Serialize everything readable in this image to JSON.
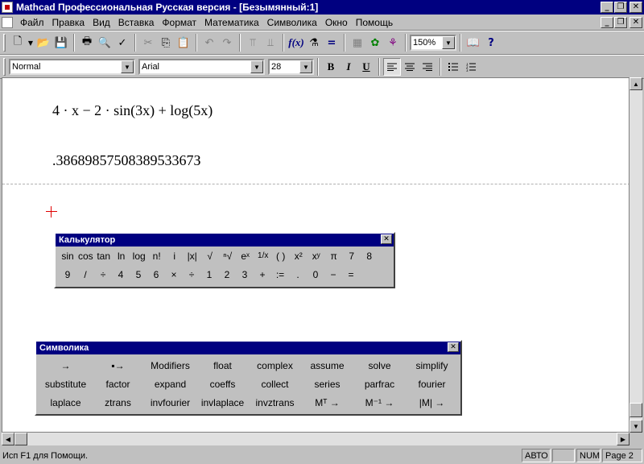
{
  "window": {
    "title": "Mathcad Профессиональная Русская версия - [Безымянный:1]",
    "buttons": [
      "_",
      "❐",
      "✕"
    ]
  },
  "menu": [
    "Файл",
    "Правка",
    "Вид",
    "Вставка",
    "Формат",
    "Математика",
    "Символика",
    "Окно",
    "Помощь"
  ],
  "toolbar": {
    "zoom": "150%"
  },
  "format_bar": {
    "style": "Normal",
    "font": "Arial",
    "size": "28",
    "bold": "B",
    "italic": "I",
    "underline": "U"
  },
  "document": {
    "expression": "4 · x − 2 · sin(3x) + log(5x)",
    "result": ".3868985750838953367З"
  },
  "calculator": {
    "title": "Калькулятор",
    "row1": [
      "sin",
      "cos",
      "tan",
      "ln",
      "log",
      "n!",
      "i",
      "|x|",
      "√",
      "ⁿ√",
      "eˣ",
      "1/x",
      "( )",
      "x²",
      "xʸ",
      "π",
      "7",
      "8"
    ],
    "row2": [
      "9",
      "/",
      "÷",
      "4",
      "5",
      "6",
      "×",
      "÷",
      "1",
      "2",
      "3",
      "+",
      ":=",
      ".",
      "0",
      "−",
      "="
    ]
  },
  "symbolics": {
    "title": "Символика",
    "buttons": [
      "→",
      "▪→",
      "Modifiers",
      "float",
      "complex",
      "assume",
      "solve",
      "simplify",
      "substitute",
      "factor",
      "expand",
      "coeffs",
      "collect",
      "series",
      "parfrac",
      "fourier",
      "laplace",
      "ztrans",
      "invfourier",
      "invlaplace",
      "invztrans",
      "Mᵀ →",
      "M⁻¹ →",
      "|M| →"
    ]
  },
  "status": {
    "help": "Исп F1 для Помощи.",
    "mode": "АВТО",
    "num": "NUM",
    "page": "Page 2"
  }
}
